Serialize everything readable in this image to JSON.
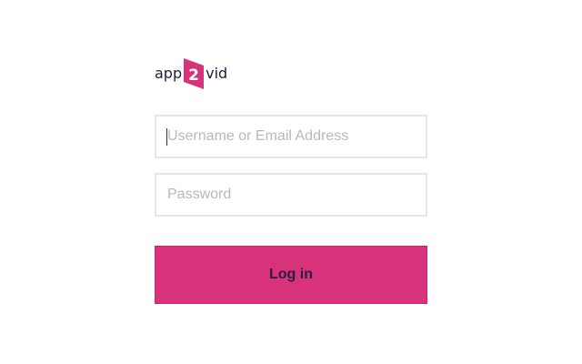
{
  "logo": {
    "left_text": "app",
    "mark_text": "2",
    "right_text": "vid",
    "mark_color": "#d6337b"
  },
  "form": {
    "username": {
      "placeholder": "Username or Email Address",
      "value": ""
    },
    "password": {
      "placeholder": "Password",
      "value": ""
    },
    "login_label": "Log in"
  },
  "colors": {
    "accent": "#d6337b",
    "button_text": "#2a1b45",
    "field_border": "#e6e6e6",
    "placeholder": "#b9b9b9"
  }
}
